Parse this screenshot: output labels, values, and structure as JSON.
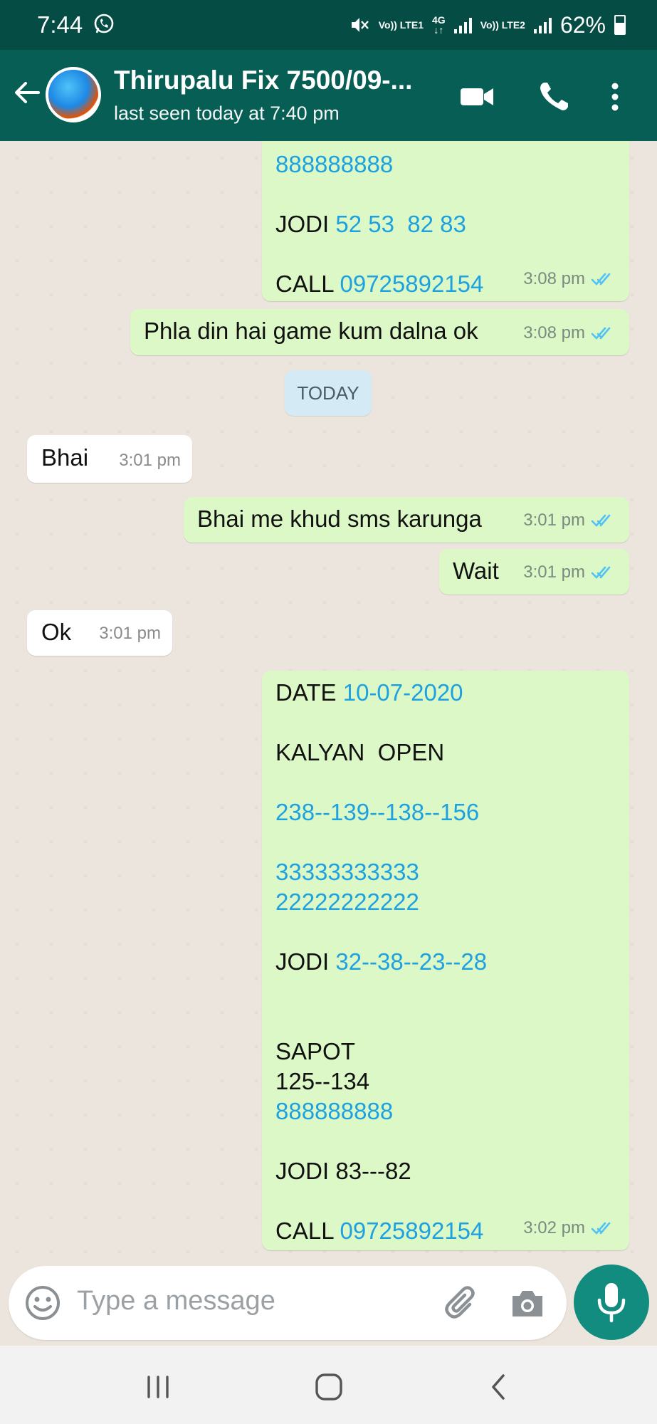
{
  "status_bar": {
    "time": "7:44",
    "battery": "62%",
    "sim1_label": "Vo)) LTE1",
    "sim2_label": "Vo)) LTE2",
    "network": "4G",
    "icons": [
      "whatsapp-icon",
      "mute-icon",
      "signal-icon",
      "battery-icon"
    ]
  },
  "header": {
    "contact_name": "Thirupalu Fix 7500/09-...",
    "last_seen": "last seen today at 7:40 pm",
    "icons": [
      "back-arrow-icon",
      "video-call-icon",
      "voice-call-icon",
      "more-options-icon"
    ]
  },
  "date_chip": "TODAY",
  "messages": [
    {
      "direction": "out",
      "lines": [
        [
          {
            "t": "888888888",
            "link": true
          }
        ],
        [],
        [
          {
            "t": "JODI "
          },
          {
            "t": "52 53  82 83",
            "link": true
          }
        ],
        [],
        [
          {
            "t": "CALL "
          },
          {
            "t": "09725892154",
            "link": true
          }
        ]
      ],
      "time": "3:08 pm"
    },
    {
      "direction": "out",
      "lines": [
        [
          {
            "t": "Phla din hai game kum dalna ok"
          }
        ]
      ],
      "time": "3:08 pm"
    },
    {
      "direction": "in",
      "lines": [
        [
          {
            "t": "Bhai"
          }
        ]
      ],
      "time": "3:01 pm"
    },
    {
      "direction": "out",
      "lines": [
        [
          {
            "t": "Bhai me khud sms karunga"
          }
        ]
      ],
      "time": "3:01 pm"
    },
    {
      "direction": "out",
      "lines": [
        [
          {
            "t": "Wait"
          }
        ]
      ],
      "time": "3:01 pm"
    },
    {
      "direction": "in",
      "lines": [
        [
          {
            "t": "Ok"
          }
        ]
      ],
      "time": "3:01 pm"
    },
    {
      "direction": "out",
      "lines": [
        [
          {
            "t": "DATE "
          },
          {
            "t": "10-07-2020",
            "link": true
          }
        ],
        [],
        [
          {
            "t": "KALYAN  OPEN"
          }
        ],
        [],
        [
          {
            "t": "238--139--138--156",
            "link": true
          }
        ],
        [],
        [
          {
            "t": "33333333333",
            "link": true
          }
        ],
        [
          {
            "t": "22222222222",
            "link": true
          }
        ],
        [],
        [
          {
            "t": "JODI "
          },
          {
            "t": "32--38--23--28",
            "link": true
          }
        ],
        [],
        [],
        [
          {
            "t": "SAPOT"
          }
        ],
        [
          {
            "t": "125--134"
          }
        ],
        [
          {
            "t": "888888888",
            "link": true
          }
        ],
        [],
        [
          {
            "t": "JODI 83---82"
          }
        ],
        [],
        [
          {
            "t": "CALL "
          },
          {
            "t": "09725892154",
            "link": true
          }
        ]
      ],
      "time": "3:02 pm"
    }
  ],
  "composer": {
    "placeholder": "Type a message",
    "icons": [
      "emoji-icon",
      "attach-icon",
      "camera-icon",
      "mic-icon"
    ]
  },
  "nav_bar": {
    "icons": [
      "recent-apps-icon",
      "home-icon",
      "back-icon"
    ]
  },
  "colors": {
    "header": "#075e54",
    "status_bar": "#054d44",
    "outgoing_bubble": "#dcf8c6",
    "incoming_bubble": "#ffffff",
    "link": "#1da1e0",
    "read_ticks": "#4fc3f7",
    "mic_button": "#128c7e"
  }
}
